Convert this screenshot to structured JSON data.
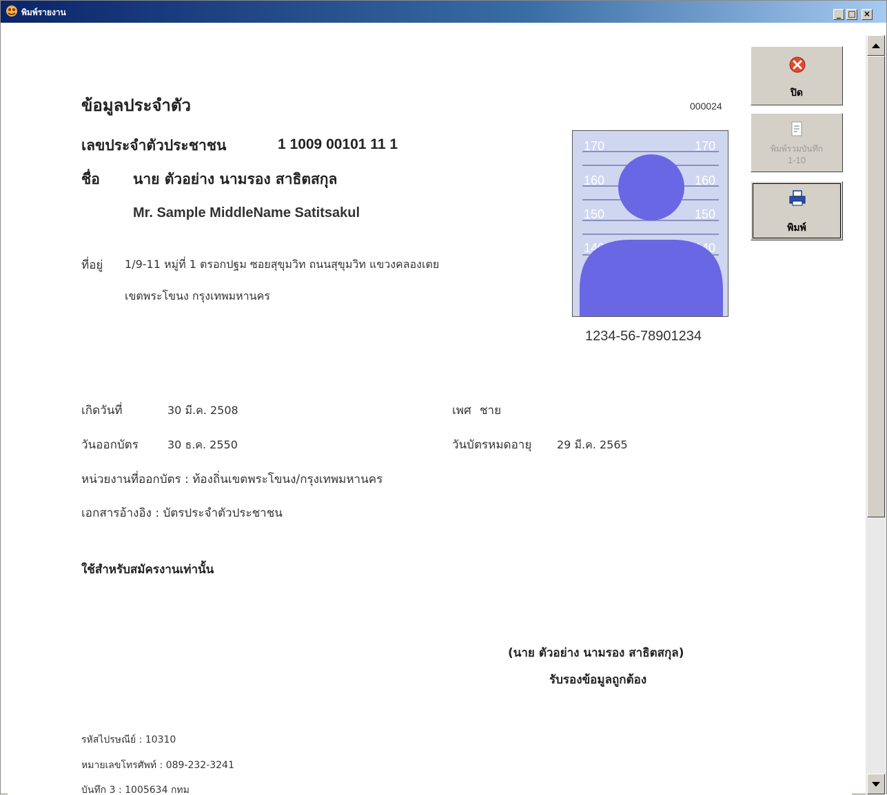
{
  "window": {
    "title": "พิมพ์รายงาน",
    "minimize": "_",
    "maximize": "□",
    "close": "×"
  },
  "report": {
    "heading": "ข้อมูลประจำตัว",
    "record_no": "000024",
    "id_label": "เลขประจำตัวประชาชน",
    "id_value": "1 1009 00101 11 1",
    "name_label": "ชื่อ",
    "name_th": "นาย ตัวอย่าง นามรอง สาธิตสกุล",
    "name_en": "Mr. Sample MiddleName Satitsakul",
    "address_label": "ที่อยู่",
    "address_line1": "1/9-11 หมู่ที่ 1 ตรอกปฐม ซอยสุขุมวิท ถนนสุขุมวิท แขวงคลองเตย",
    "address_line2": "เขตพระโขนง กรุงเทพมหานคร",
    "photo_ruler": [
      "170",
      "160",
      "150",
      "140"
    ],
    "card_number": "1234-56-78901234",
    "birth_label": "เกิดวันที่",
    "birth_value": "30 มี.ค. 2508",
    "sex_label": "เพศ",
    "sex_value": "ชาย",
    "issue_label": "วันออกบัตร",
    "issue_value": "30 ธ.ค. 2550",
    "expiry_label": "วันบัตรหมดอายุ",
    "expiry_value": "29 มี.ค. 2565",
    "agency_line": "หน่วยงานที่ออกบัตร : ท้องถิ่นเขตพระโขนง/กรุงเทพมหานคร",
    "reference_line": "เอกสารอ้างอิง : บัตรประจำตัวประชาชน",
    "usage_note": "ใช้สำหรับสมัครงานเท่านั้น",
    "signature_name": "(นาย ตัวอย่าง นามรอง สาธิตสกุล)",
    "signature_caption": "รับรองข้อมูลถูกต้อง",
    "postal_line": "รหัสไปรษณีย์ : 10310",
    "phone_line": "หมายเลขโทรศัพท์ : 089-232-3241",
    "note3_line": "บันทึก 3 : 1005634 กทม"
  },
  "toolbar": {
    "close_label": "ปิด",
    "print_all_label_1": "พิมพ์รวมบันทึก",
    "print_all_label_2": "1-10",
    "print_label": "พิมพ์"
  },
  "colors": {
    "silhouette": "#6a67e4",
    "photo_bg": "#cfd6f0",
    "close_icon": "#e14a2a"
  }
}
